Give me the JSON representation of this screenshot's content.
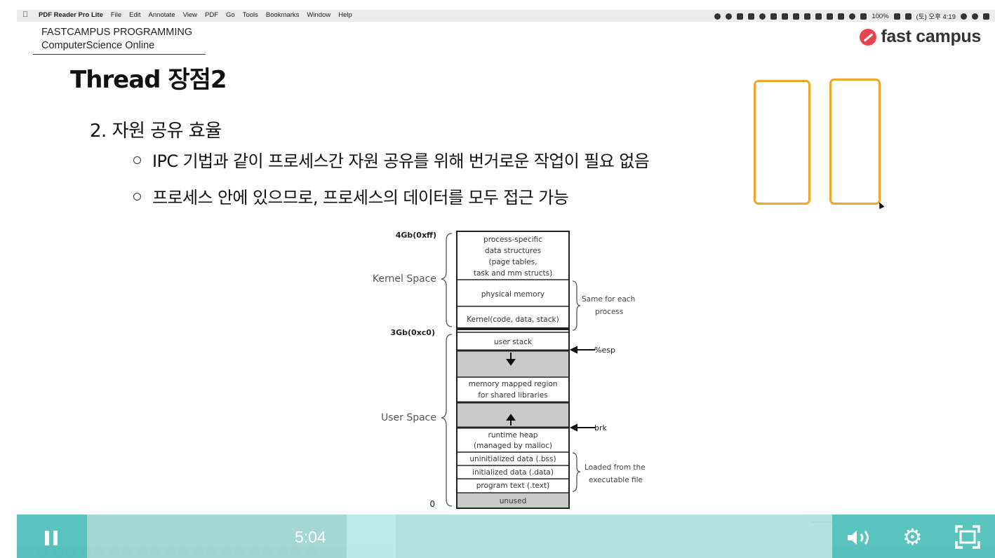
{
  "menubar": {
    "app_name": "PDF Reader Pro Lite",
    "menus": [
      "File",
      "Edit",
      "Annotate",
      "View",
      "PDF",
      "Go",
      "Tools",
      "Bookmarks",
      "Window",
      "Help"
    ],
    "battery": "100%",
    "clock": "(토) 오후 4:19"
  },
  "slide": {
    "brand_line1": "FASTCAMPUS PROGRAMMING",
    "brand_line2": "ComputerScience Online",
    "logo_text": "fast campus",
    "title": "Thread 장점2",
    "point": "2. 자원 공유 효율",
    "bullets": [
      "IPC 기법과 같이 프로세스간 자원 공유를 위해 번거로운 작업이 필요 없음",
      "프로세스 안에 있으므로, 프로세스의 데이터를 모두 접근 가능"
    ]
  },
  "diagram": {
    "addr_top": "4Gb(0xff)",
    "addr_mid": "3Gb(0xc0)",
    "addr_bottom": "0",
    "kernel_label": "Kernel Space",
    "user_label": "User Space",
    "blocks": {
      "proc_specific": [
        "process-specific",
        "data structures",
        "(page tables,",
        "task and mm structs)"
      ],
      "physical": "physical memory",
      "kernel_code": "Kernel(code, data, stack)",
      "user_stack": "user stack",
      "mmap": [
        "memory mapped region",
        "for shared libraries"
      ],
      "heap": [
        "runtime heap",
        "(managed by malloc)"
      ],
      "bss": "uninitialized data (.bss)",
      "data": "initialized data (.data)",
      "text": "program text (.text)",
      "unused": "unused"
    },
    "same_note": [
      "Same for each",
      "process"
    ],
    "loaded_note": [
      "Loaded from the",
      "executable file"
    ],
    "esp": "%esp",
    "brk": "brk"
  },
  "player": {
    "time": "5:04"
  },
  "icons": {
    "pause": "pause-icon",
    "volume": "volume-icon",
    "settings": "gear-icon",
    "fullscreen": "fullscreen-icon"
  }
}
